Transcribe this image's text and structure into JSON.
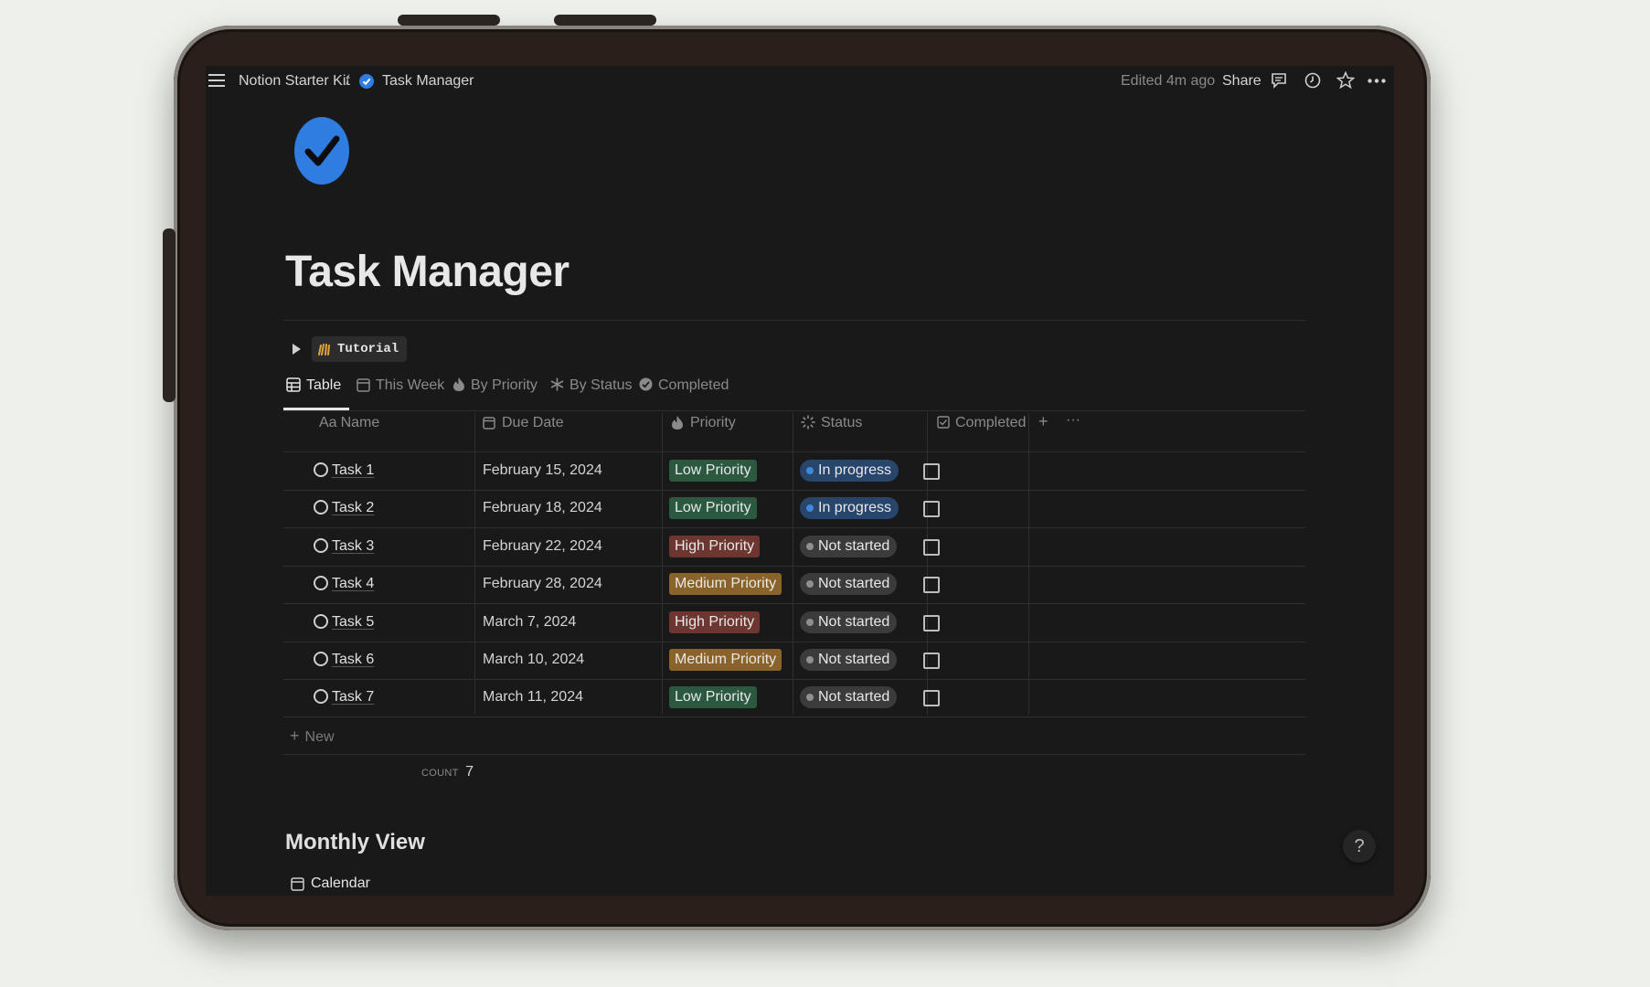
{
  "topbar": {
    "menu_icon": "hamburger-icon",
    "breadcrumb_parent": "Notion Starter Kit",
    "breadcrumb_separator": "/",
    "breadcrumb_current": "Task Manager",
    "edited": "Edited 4m ago",
    "share": "Share",
    "icons": [
      "comments-icon",
      "history-icon",
      "star-icon",
      "more-icon"
    ]
  },
  "page": {
    "icon": "check-circle-icon",
    "icon_color": "#2f7de1",
    "title": "Task Manager",
    "toggle_label": "Tutorial"
  },
  "views": [
    {
      "label": "Table",
      "icon": "table-icon",
      "active": true
    },
    {
      "label": "This Week",
      "icon": "calendar-icon",
      "active": false
    },
    {
      "label": "By Priority",
      "icon": "fire-icon",
      "active": false
    },
    {
      "label": "By Status",
      "icon": "asterisk-icon",
      "active": false
    },
    {
      "label": "Completed",
      "icon": "check-circle-icon",
      "active": false
    }
  ],
  "table": {
    "headers": {
      "name": "Name",
      "name_prefix": "Aa",
      "due_date": "Due Date",
      "priority": "Priority",
      "status": "Status",
      "completed": "Completed",
      "add": "+",
      "more": "···"
    },
    "rows": [
      {
        "name": "Task 1",
        "due": "February 15, 2024",
        "priority": "Low Priority",
        "status": "In progress",
        "completed": false
      },
      {
        "name": "Task 2",
        "due": "February 18, 2024",
        "priority": "Low Priority",
        "status": "In progress",
        "completed": false
      },
      {
        "name": "Task 3",
        "due": "February 22, 2024",
        "priority": "High Priority",
        "status": "Not started",
        "completed": false
      },
      {
        "name": "Task 4",
        "due": "February 28, 2024",
        "priority": "Medium Priority",
        "status": "Not started",
        "completed": false
      },
      {
        "name": "Task 5",
        "due": "March 7, 2024",
        "priority": "High Priority",
        "status": "Not started",
        "completed": false
      },
      {
        "name": "Task 6",
        "due": "March 10, 2024",
        "priority": "Medium Priority",
        "status": "Not started",
        "completed": false
      },
      {
        "name": "Task 7",
        "due": "March 11, 2024",
        "priority": "Low Priority",
        "status": "Not started",
        "completed": false
      }
    ],
    "new_label": "New",
    "count_label": "COUNT",
    "count_value": "7"
  },
  "colors": {
    "Low Priority": "#2b593f",
    "High Priority": "#6e3630",
    "Medium Priority": "#89632a",
    "In progress": "#28456c",
    "In progress_dot": "#3f87d8",
    "Not started": "#3b3b3b",
    "Not started_dot": "#8f8f8f"
  },
  "section": {
    "heading": "Monthly View",
    "calendar_label": "Calendar"
  },
  "help": "?"
}
